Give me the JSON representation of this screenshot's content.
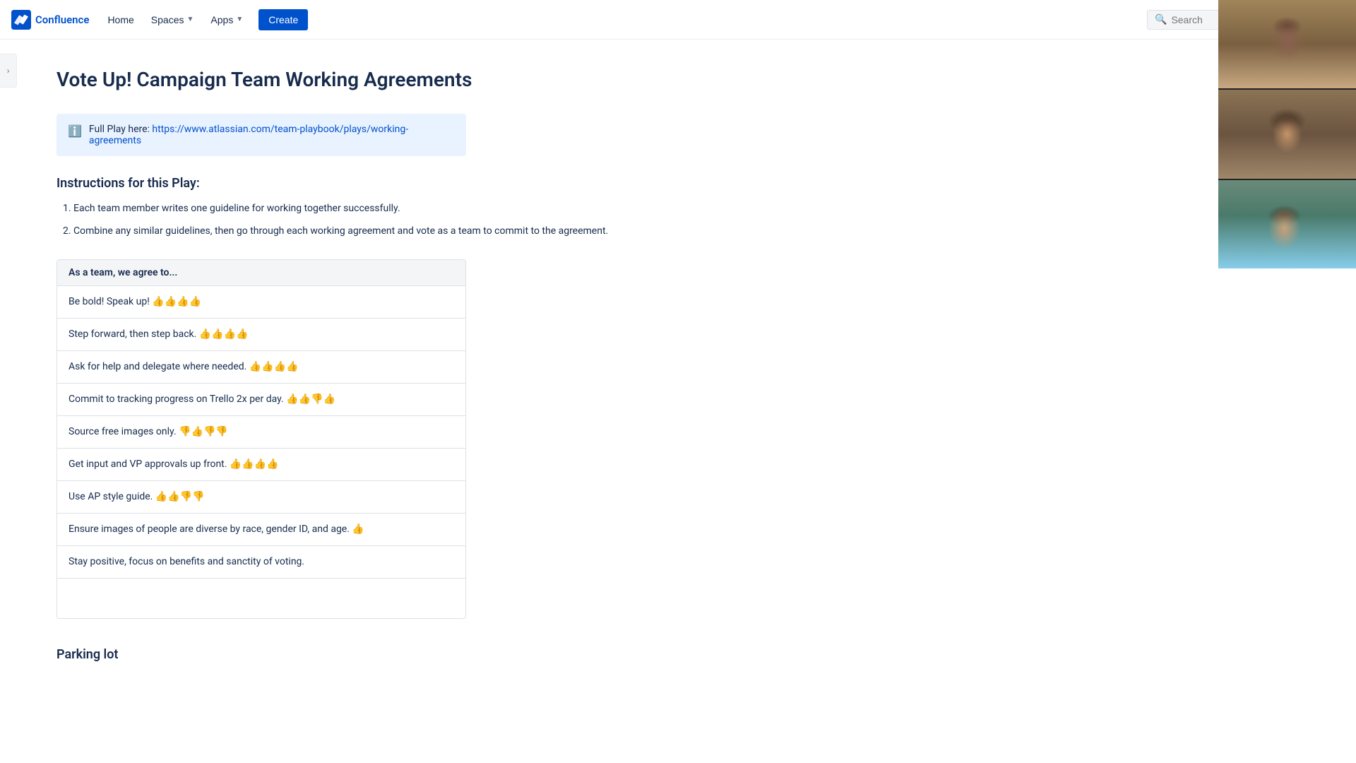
{
  "nav": {
    "logo_text": "Confluence",
    "home_label": "Home",
    "spaces_label": "Spaces",
    "apps_label": "Apps",
    "create_label": "Create",
    "search_placeholder": "Search"
  },
  "page": {
    "title": "Vote Up! Campaign Team Working Agreements",
    "info_prefix": "Full Play here: ",
    "info_link_text": "https://www.atlassian.com/team-playbook/plays/working-agreements",
    "info_link_url": "https://www.atlassian.com/team-playbook/plays/working-agreements",
    "instructions_heading": "Instructions for this Play:",
    "instructions": [
      "Each team member writes one guideline for working together successfully.",
      "Combine any similar guidelines, then go through each working agreement and vote as a team to commit to the agreement."
    ],
    "agreements_heading": "As a team, we agree to...",
    "agreements": [
      "Be bold! Speak up! 👍👍👍👍",
      "Step forward, then step back. 👍👍👍👍",
      "Ask for help and delegate where needed. 👍👍👍👍",
      "Commit to tracking progress on Trello 2x per day. 👍👍👎👍",
      "Source free images only. 👎👍👎👎",
      "Get input and VP approvals up front. 👍👍👍👍",
      "Use AP style guide. 👍👍👎👎",
      "Ensure images of people are diverse by race, gender ID, and age. 👍",
      "Stay positive, focus on benefits and sanctity of voting."
    ],
    "parking_lot_heading": "Parking lot"
  },
  "sidebar": {
    "toggle_icon": "›"
  }
}
